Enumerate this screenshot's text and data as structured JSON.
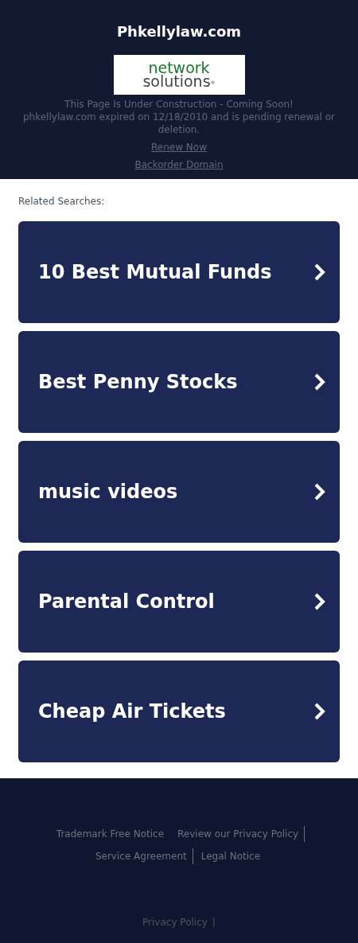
{
  "header": {
    "title": "Phkellylaw.com",
    "logo": {
      "line_1": "network",
      "line_2": "solutions",
      "mark": "®"
    },
    "notice": "This Page Is Under Construction - Coming Soon!",
    "expiry": "phkellylaw.com expired on 12/18/2010 and is pending renewal or deletion.",
    "links": [
      "Renew Now",
      "Backorder Domain"
    ]
  },
  "related": {
    "label": "Related Searches:",
    "items": [
      {
        "label": "10 Best Mutual Funds"
      },
      {
        "label": "Best Penny Stocks"
      },
      {
        "label": "music videos"
      },
      {
        "label": "Parental Control"
      },
      {
        "label": "Cheap Air Tickets"
      }
    ]
  },
  "footer": {
    "links": [
      {
        "label": "Trademark Free Notice",
        "divider_after": false
      },
      {
        "label": "Review our Privacy Policy",
        "divider_after": true
      },
      {
        "label": "Service Agreement",
        "divider_after": true
      },
      {
        "label": "Legal Notice",
        "divider_after": false
      }
    ],
    "bottom_link": "Privacy Policy",
    "bottom_separator": "|"
  }
}
